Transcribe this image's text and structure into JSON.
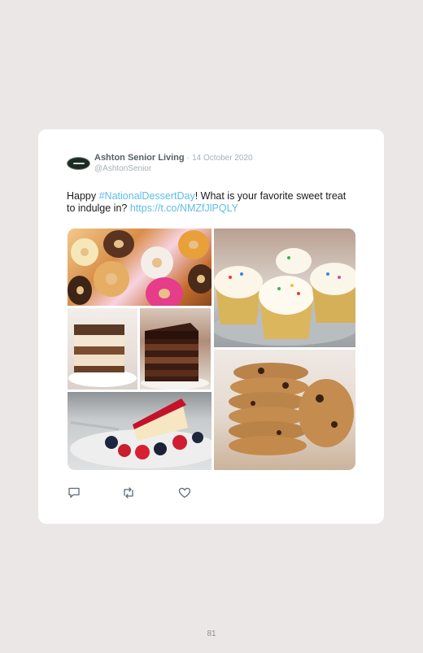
{
  "tweet": {
    "author_name": "Ashton Senior Living",
    "separator": "·",
    "date": "14 October 2020",
    "handle": "@AshtonSenior",
    "text_before": "Happy ",
    "hashtag": "#NationalDessertDay",
    "text_after": "! What is your favorite sweet treat to indulge in? ",
    "link": "https://t.co/NMZfJlPQLY"
  },
  "media": {
    "images": [
      "donuts",
      "tiramisu",
      "chocolate-cake",
      "cheesecake-with-berries",
      "cupcakes",
      "chocolate-chip-cookies"
    ]
  },
  "actions": [
    "reply-icon",
    "retweet-icon",
    "like-icon"
  ],
  "page_number": "81",
  "colors": {
    "link": "#5ebde8",
    "background": "#ece7e7",
    "card": "#ffffff"
  }
}
